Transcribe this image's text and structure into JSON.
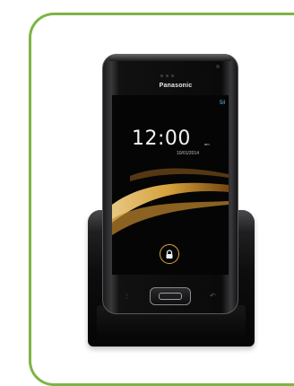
{
  "product": {
    "brand_text": "Panasonic",
    "clock_time": "12:00",
    "clock_period": "am",
    "date_text": "10/01/2014",
    "status_text": "5il"
  },
  "colors": {
    "frame_border": "#7cb544",
    "swoosh_gold": "#e0a83c",
    "handset_body": "#0a0a0a"
  },
  "icons": {
    "lock": "lock-icon",
    "signal": "signal-icon",
    "home": "home-key-icon",
    "menu": "menu-key-icon",
    "back": "back-key-icon"
  }
}
